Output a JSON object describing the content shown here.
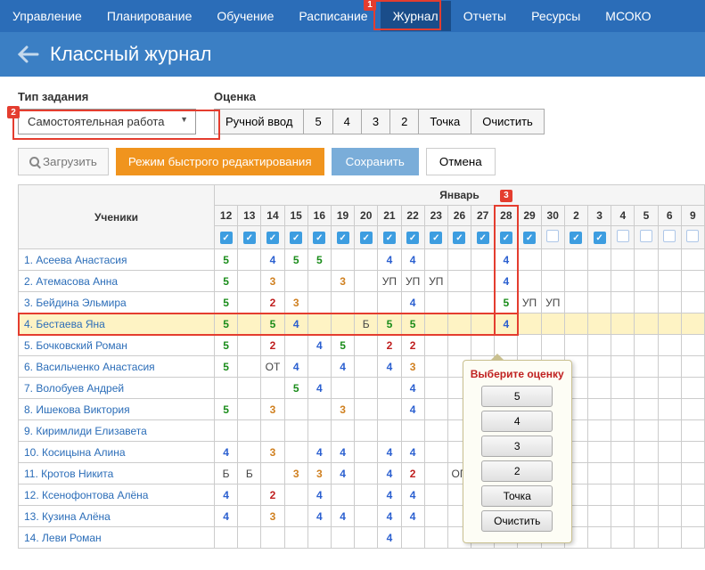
{
  "nav": {
    "items": [
      "Управление",
      "Планирование",
      "Обучение",
      "Расписание",
      "Журнал",
      "Отчеты",
      "Ресурсы",
      "МСОКО"
    ],
    "active_index": 4
  },
  "page_title": "Классный журнал",
  "task_type": {
    "label": "Тип задания",
    "value": "Самостоятельная работа"
  },
  "grade_label": "Оценка",
  "grade_buttons": [
    "Ручной ввод",
    "5",
    "4",
    "3",
    "2",
    "Точка",
    "Очистить"
  ],
  "actions": {
    "load": "Загрузить",
    "fast_edit": "Режим быстрого редактирования",
    "save": "Сохранить",
    "cancel": "Отмена"
  },
  "students_header": "Ученики",
  "month": "Январь",
  "days": [
    "12",
    "13",
    "14",
    "15",
    "16",
    "19",
    "20",
    "21",
    "22",
    "23",
    "26",
    "27",
    "28",
    "29",
    "30",
    "2",
    "3",
    "4",
    "5",
    "6",
    "9"
  ],
  "checked_days": [
    true,
    true,
    true,
    true,
    true,
    true,
    true,
    true,
    true,
    true,
    true,
    true,
    true,
    true,
    false,
    true,
    true,
    false,
    false,
    false,
    false
  ],
  "highlight_col": 12,
  "students": [
    {
      "n": 1,
      "name": "Асеева Анастасия",
      "grades": [
        "5",
        "",
        "4",
        "5",
        "5",
        "",
        "",
        "4",
        "4",
        "",
        "",
        "",
        "4",
        "",
        "",
        "",
        "",
        "",
        "",
        "",
        ""
      ]
    },
    {
      "n": 2,
      "name": "Атемасова Анна",
      "grades": [
        "5",
        "",
        "3",
        "",
        "",
        "3",
        "",
        "УП",
        "УП",
        "УП",
        "",
        "",
        "4",
        "",
        "",
        "",
        "",
        "",
        "",
        "",
        ""
      ]
    },
    {
      "n": 3,
      "name": "Бейдина Эльмира",
      "grades": [
        "5",
        "",
        "2",
        "3",
        "",
        "",
        "",
        "",
        "4",
        "",
        "",
        "",
        "5",
        "УП",
        "УП",
        "",
        "",
        "",
        "",
        "",
        ""
      ]
    },
    {
      "n": 4,
      "name": "Бестаева Яна",
      "grades": [
        "5",
        "",
        "5",
        "4",
        "",
        "",
        "Б",
        "5",
        "5",
        "",
        "",
        "",
        "4",
        "",
        "",
        "",
        "",
        "",
        "",
        "",
        ""
      ],
      "hl": true
    },
    {
      "n": 5,
      "name": "Бочковский Роман",
      "grades": [
        "5",
        "",
        "2",
        "",
        "4",
        "5",
        "",
        "2",
        "2",
        "",
        "",
        "",
        "",
        "",
        "",
        "",
        "",
        "",
        "",
        "",
        ""
      ]
    },
    {
      "n": 6,
      "name": "Васильченко Анастасия",
      "grades": [
        "5",
        "",
        "ОТ",
        "4",
        "",
        "4",
        "",
        "4",
        "3",
        "",
        "",
        "",
        "",
        "",
        "",
        "",
        "",
        "",
        "",
        "",
        ""
      ]
    },
    {
      "n": 7,
      "name": "Волобуев Андрей",
      "grades": [
        "",
        "",
        "",
        "5",
        "4",
        "",
        "",
        "",
        "4",
        "",
        "",
        "",
        "",
        "",
        "",
        "",
        "",
        "",
        "",
        "",
        ""
      ]
    },
    {
      "n": 8,
      "name": "Ишекова Виктория",
      "grades": [
        "5",
        "",
        "3",
        "",
        "",
        "3",
        "",
        "",
        "4",
        "",
        "",
        "",
        "",
        "",
        "",
        "",
        "",
        "",
        "",
        "",
        ""
      ]
    },
    {
      "n": 9,
      "name": "Киримлиди Елизавета",
      "grades": [
        "",
        "",
        "",
        "",
        "",
        "",
        "",
        "",
        "",
        "",
        "",
        "",
        "",
        "",
        "",
        "",
        "",
        "",
        "",
        "",
        ""
      ]
    },
    {
      "n": 10,
      "name": "Косицына Алина",
      "grades": [
        "4",
        "",
        "3",
        "",
        "4",
        "4",
        "",
        "4",
        "4",
        "",
        "",
        "",
        "",
        "",
        "",
        "",
        "",
        "",
        "",
        "",
        ""
      ]
    },
    {
      "n": 11,
      "name": "Кротов Никита",
      "grades": [
        "Б",
        "Б",
        "",
        "3",
        "3",
        "4",
        "",
        "4",
        "2",
        "",
        "ОП",
        "",
        "",
        "",
        "",
        "",
        "",
        "",
        "",
        "",
        ""
      ]
    },
    {
      "n": 12,
      "name": "Ксенофонтова Алёна",
      "grades": [
        "4",
        "",
        "2",
        "",
        "4",
        "",
        "",
        "4",
        "4",
        "",
        "",
        "",
        "",
        "",
        "",
        "",
        "",
        "",
        "",
        "",
        ""
      ]
    },
    {
      "n": 13,
      "name": "Кузина Алёна",
      "grades": [
        "4",
        "",
        "3",
        "",
        "4",
        "4",
        "",
        "4",
        "4",
        "",
        "",
        "",
        "",
        "",
        "",
        "",
        "",
        "",
        "",
        "",
        ""
      ]
    },
    {
      "n": 14,
      "name": "Леви Роман",
      "grades": [
        "",
        "",
        "",
        "",
        "",
        "",
        "",
        "4",
        "",
        "",
        "",
        "",
        "",
        "",
        "",
        "",
        "",
        "",
        "",
        "",
        ""
      ]
    }
  ],
  "popup": {
    "title": "Выберите оценку",
    "options": [
      "5",
      "4",
      "3",
      "2",
      "Точка",
      "Очистить"
    ]
  },
  "annotations": {
    "1": "1",
    "2": "2",
    "3": "3"
  }
}
